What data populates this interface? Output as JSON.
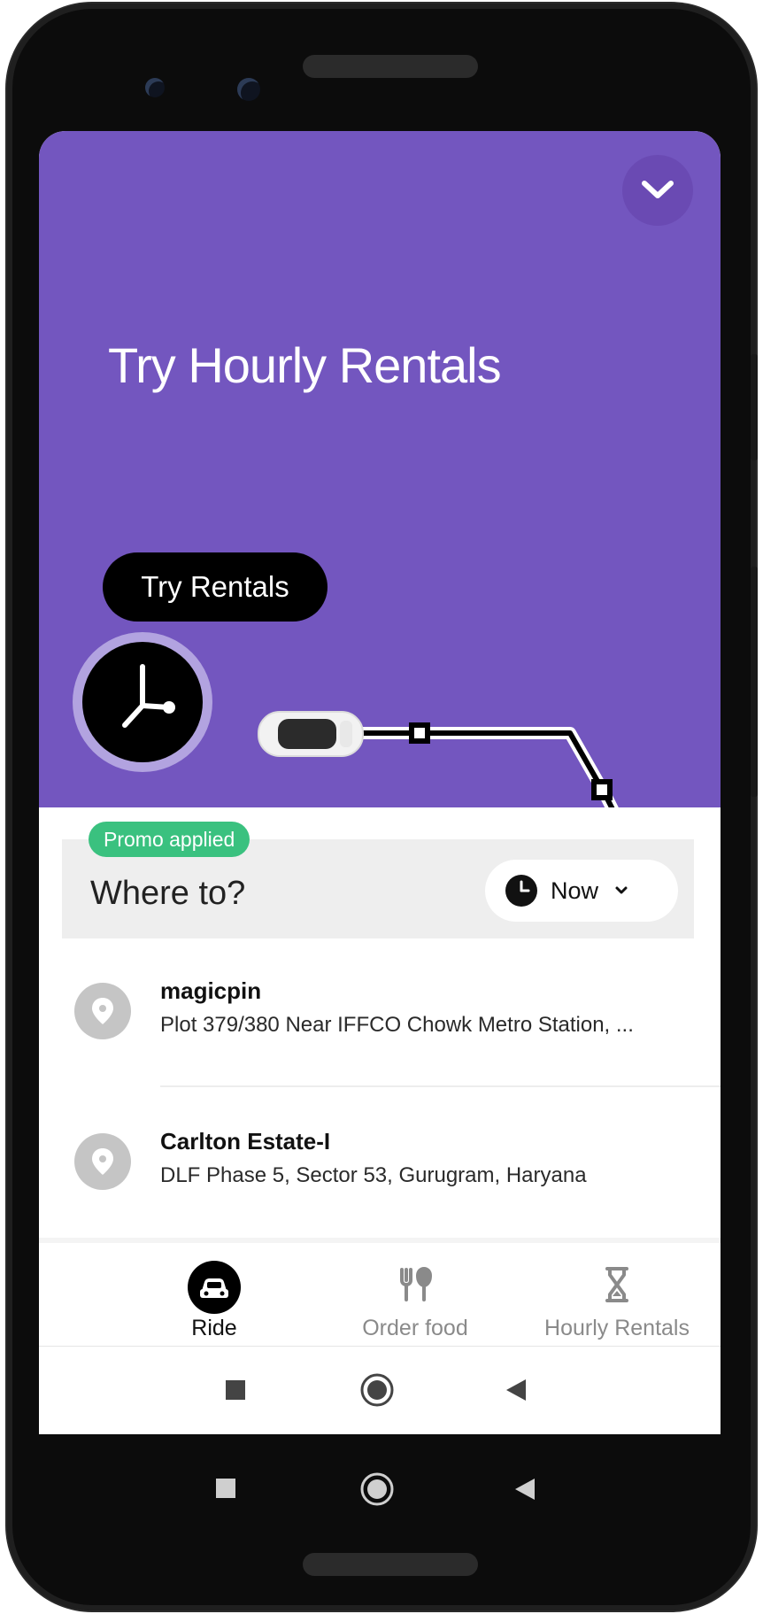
{
  "hero": {
    "title": "Try Hourly Rentals",
    "cta_label": "Try Rentals",
    "background": "#7356bf"
  },
  "search": {
    "promo_badge": "Promo applied",
    "placeholder": "Where to?",
    "time_selector": "Now"
  },
  "recent_places": [
    {
      "name": "magicpin",
      "address": "Plot 379/380 Near IFFCO Chowk Metro Station, ..."
    },
    {
      "name": "Carlton Estate-I",
      "address": "DLF Phase 5, Sector 53, Gurugram, Haryana"
    }
  ],
  "tabs": [
    {
      "label": "Ride",
      "icon": "car-icon",
      "active": true
    },
    {
      "label": "Order food",
      "icon": "fork-knife-icon",
      "active": false
    },
    {
      "label": "Hourly Rentals",
      "icon": "hourglass-icon",
      "active": false
    }
  ],
  "colors": {
    "accent": "#7356bf",
    "promo": "#3ac17f",
    "active_tab": "#000000",
    "inactive_tab": "#8a8a8a"
  }
}
